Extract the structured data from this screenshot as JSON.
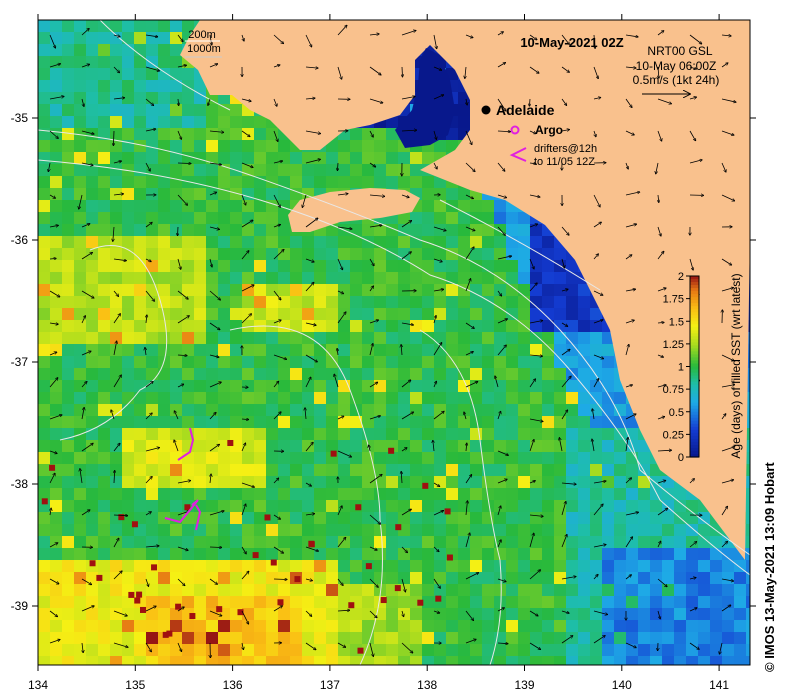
{
  "title": "10-May-2021 02Z",
  "current_info": {
    "line1": "NRT00 GSL",
    "line2": "10-May 06:00Z",
    "line3": "0.5m/s (1kt 24h)"
  },
  "depth_legend": {
    "line1": "200m",
    "line2": "1000m"
  },
  "city": "Adelaide",
  "argo_label": "Argo",
  "drifter_label": {
    "line1": "drifters@12h",
    "line2": "to 11/05 12Z"
  },
  "colorbar": {
    "label": "Age (days) of filled SST (wrt latest)",
    "ticks": [
      "0",
      "0.25",
      "0.5",
      "0.75",
      "1",
      "1.25",
      "1.5",
      "1.75",
      "2"
    ]
  },
  "axes": {
    "x_ticks": [
      "134",
      "135",
      "136",
      "137",
      "138",
      "139",
      "140",
      "141"
    ],
    "y_ticks": [
      "-35",
      "-36",
      "-37",
      "-38",
      "-39"
    ]
  },
  "credit": "© IMOS 13-May-2021 13:09 Hobart",
  "colors": {
    "land": "#f9c18d",
    "fresh": "#08188c",
    "stale": "#a01010"
  }
}
